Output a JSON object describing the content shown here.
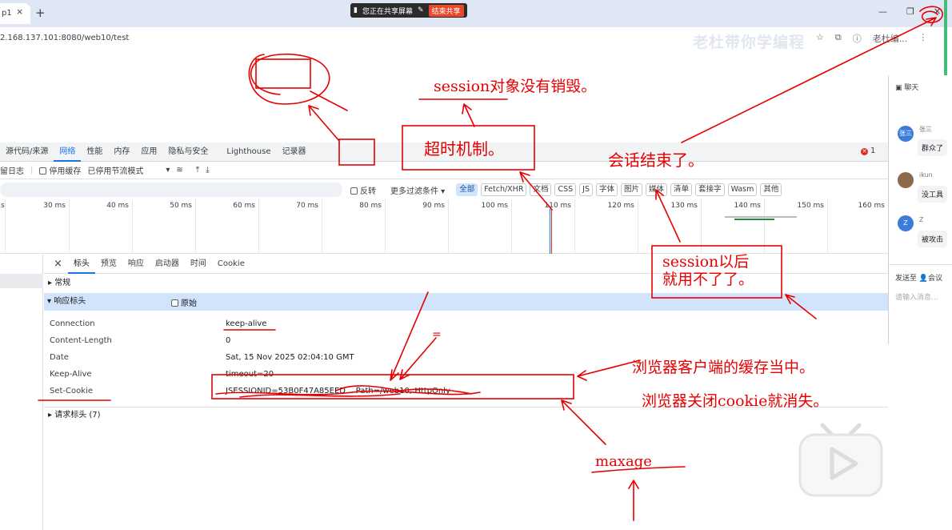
{
  "browser": {
    "tab_title": "p1",
    "tab_close": "×",
    "new_tab": "+",
    "url": "2.168.137.101:8080/web10/test",
    "share_text": "您正在共享屏幕",
    "share_stop": "结束共享",
    "watermark": "老杜带你学编程",
    "window_minimize": "—",
    "window_restore": "❐",
    "window_close": "✕",
    "profile_label": "老杜编..."
  },
  "devtools": {
    "tabs": [
      "源代码/来源",
      "网络",
      "性能",
      "内存",
      "应用",
      "隐私与安全",
      "Lighthouse",
      "记录器"
    ],
    "active_tab": "网络",
    "error_count": "1",
    "network_toolbar": {
      "preserve_log": "留日志",
      "disable_cache": "停用缓存",
      "throttling": "已停用节流模式"
    },
    "filter": {
      "invert": "反转",
      "more_filters": "更多过滤条件",
      "chips": [
        "全部",
        "Fetch/XHR",
        "文档",
        "CSS",
        "JS",
        "字体",
        "图片",
        "媒体",
        "清单",
        "套接字",
        "Wasm",
        "其他"
      ],
      "active_chip": "全部"
    },
    "timeline_ticks": [
      "s",
      "30 ms",
      "40 ms",
      "50 ms",
      "60 ms",
      "70 ms",
      "80 ms",
      "90 ms",
      "100 ms",
      "110 ms",
      "120 ms",
      "130 ms",
      "140 ms",
      "150 ms",
      "160 ms"
    ],
    "detail_tabs": [
      "标头",
      "预览",
      "响应",
      "启动器",
      "时间",
      "Cookie"
    ],
    "active_detail_tab": "标头",
    "close_detail": "×",
    "sections": {
      "general": "▸ 常规",
      "response_headers": "▾ 响应标头",
      "raw": "原始",
      "request_headers": "▸ 请求标头 (7)"
    },
    "response_headers": [
      {
        "name": "Connection",
        "value": "keep-alive"
      },
      {
        "name": "Content-Length",
        "value": "0"
      },
      {
        "name": "Date",
        "value": "Sat, 15 Nov 2025 02:04:10 GMT"
      },
      {
        "name": "Keep-Alive",
        "value": "timeout=20"
      },
      {
        "name": "Set-Cookie",
        "value": "JSESSIONID=53B0F47A85EED... Path=/web10; HttpOnly"
      }
    ]
  },
  "chat": {
    "title": "聊天",
    "messages": [
      {
        "avatar": "张三",
        "name": "张三",
        "text": "群众了",
        "color": "#3b7dd8"
      },
      {
        "avatar": "",
        "name": "ikun",
        "text": "没工具",
        "color": "#8a6a4a"
      },
      {
        "avatar": "Z",
        "name": "Z",
        "text": "被攻击",
        "color": "#3b7dd8"
      }
    ],
    "send_to": "发送至",
    "send_to_target": "会议",
    "input_placeholder": "请输入消息..."
  },
  "annotations": {
    "session_not_destroyed": "session对象没有销毁。",
    "timeout_mechanism": "超时机制。",
    "session_ended": "会话结束了。",
    "session_unusable": "session以后\n就用不了了。",
    "browser_cache": "浏览器客户端的缓存当中。",
    "browser_close": "浏览器关闭cookie就消失。",
    "maxage": "maxage",
    "small_mark": "="
  },
  "colors": {
    "annotation": "#e60000",
    "devtools_active": "#1a73e8",
    "response_header_bg": "#d2e3fc"
  }
}
